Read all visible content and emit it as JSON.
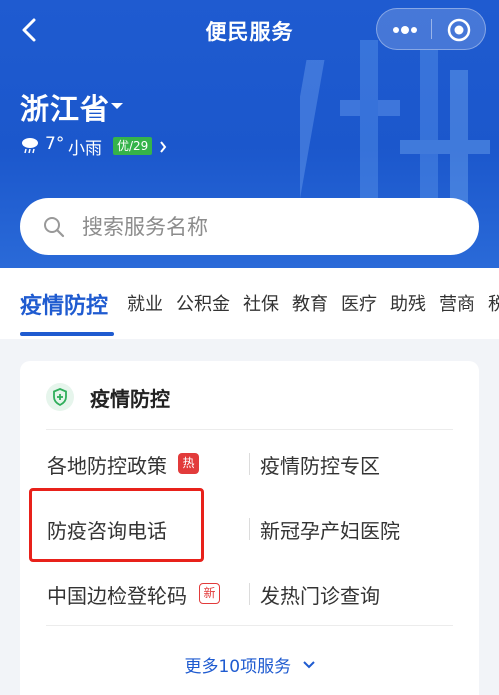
{
  "nav": {
    "title": "便民服务"
  },
  "location": {
    "province": "浙江省"
  },
  "weather": {
    "temp": "7°",
    "condition": "小雨",
    "aqi": "优/29"
  },
  "search": {
    "placeholder": "搜索服务名称"
  },
  "tabs": [
    {
      "label": "疫情防控",
      "active": true
    },
    {
      "label": "就业"
    },
    {
      "label": "公积金"
    },
    {
      "label": "社保"
    },
    {
      "label": "教育"
    },
    {
      "label": "医疗"
    },
    {
      "label": "助残"
    },
    {
      "label": "营商"
    },
    {
      "label": "税"
    }
  ],
  "card": {
    "title": "疫情防控",
    "services": [
      {
        "label": "各地防控政策",
        "badge": "热"
      },
      {
        "label": "疫情防控专区"
      },
      {
        "label": "防疫咨询电话"
      },
      {
        "label": "新冠孕产妇医院"
      },
      {
        "label": "中国边检登轮码",
        "badge": "新"
      },
      {
        "label": "发热门诊查询"
      }
    ],
    "more": "更多10项服务"
  },
  "colors": {
    "brand": "#1f5bd0",
    "highlight": "#e8211a",
    "hot": "#e23b3b",
    "aqi": "#35b34a"
  }
}
